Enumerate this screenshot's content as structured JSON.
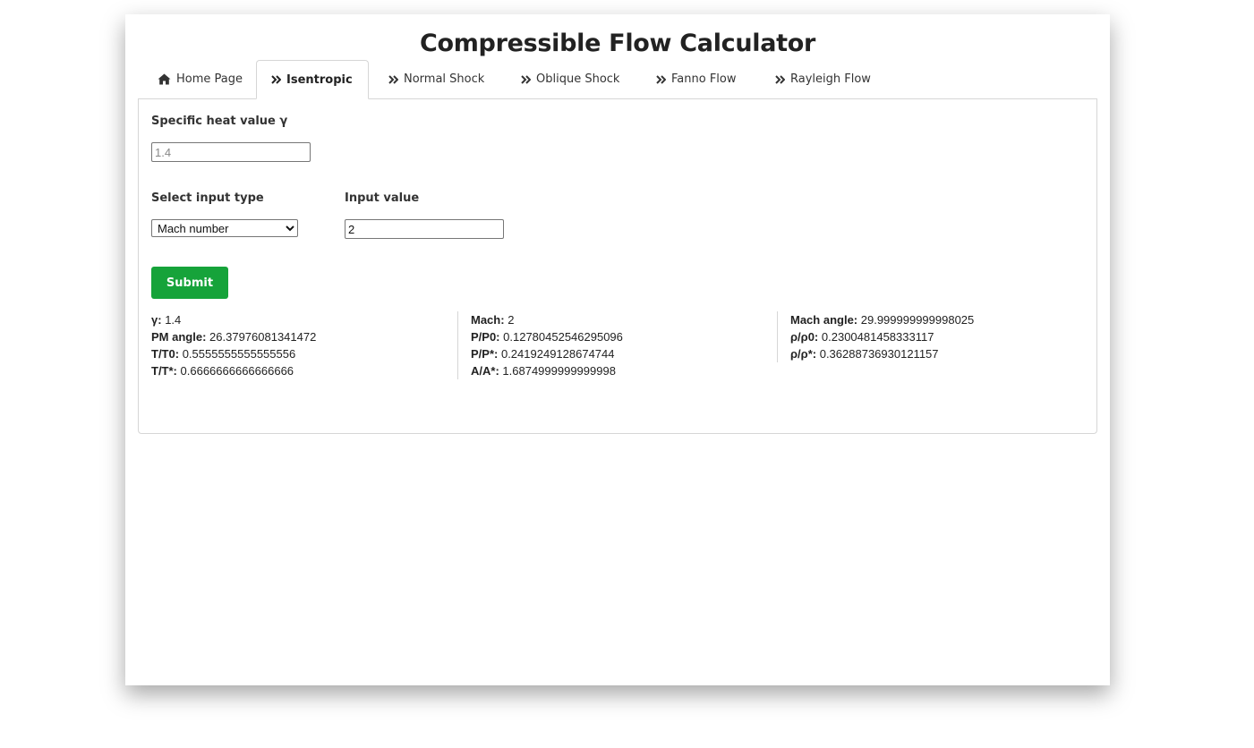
{
  "title": "Compressible Flow Calculator",
  "tabs": [
    {
      "label": "Home Page",
      "icon": "home-icon"
    },
    {
      "label": "Isentropic",
      "icon": "double-chevron-right-icon"
    },
    {
      "label": "Normal Shock",
      "icon": "double-chevron-right-icon"
    },
    {
      "label": "Oblique Shock",
      "icon": "double-chevron-right-icon"
    },
    {
      "label": "Fanno Flow",
      "icon": "double-chevron-right-icon"
    },
    {
      "label": "Rayleigh Flow",
      "icon": "double-chevron-right-icon"
    }
  ],
  "active_tab": "Isentropic",
  "form": {
    "gamma_label": "Specific heat value γ",
    "gamma_placeholder": "1.4",
    "input_type_label": "Select input type",
    "input_type_selected": "Mach number",
    "input_value_label": "Input value",
    "input_value": "2",
    "submit_label": "Submit"
  },
  "results": {
    "col1": [
      {
        "key": "γ:",
        "value": "1.4"
      },
      {
        "key": "PM angle:",
        "value": "26.37976081341472"
      },
      {
        "key": "T/T0:",
        "value": "0.5555555555555556"
      },
      {
        "key": "T/T*:",
        "value": "0.6666666666666666"
      }
    ],
    "col2": [
      {
        "key": "Mach:",
        "value": "2"
      },
      {
        "key": "P/P0:",
        "value": "0.12780452546295096"
      },
      {
        "key": "P/P*:",
        "value": "0.2419249128674744"
      },
      {
        "key": "A/A*:",
        "value": "1.6874999999999998"
      }
    ],
    "col3": [
      {
        "key": "Mach angle:",
        "value": "29.999999999998025"
      },
      {
        "key": "ρ/ρ0:",
        "value": "0.2300481458333117"
      },
      {
        "key": "ρ/ρ*:",
        "value": "0.36288736930121157"
      }
    ]
  },
  "colors": {
    "submit": "#16a33a",
    "border": "#d6d6d6"
  }
}
